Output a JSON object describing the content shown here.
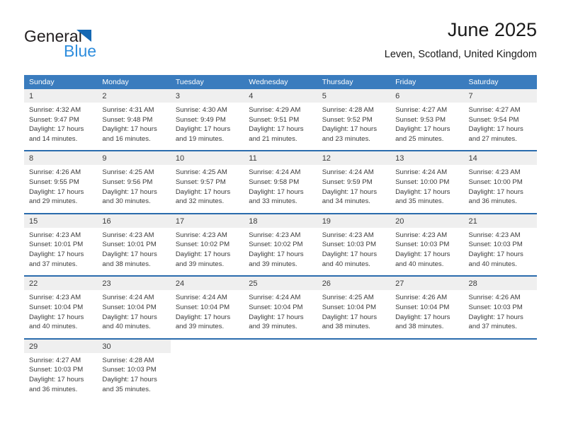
{
  "brand": {
    "name_top": "General",
    "name_bottom": "Blue",
    "triangle_color": "#1668b3",
    "blue_color": "#2e8ddd"
  },
  "header": {
    "title": "June 2025",
    "subtitle": "Leven, Scotland, United Kingdom"
  },
  "theme": {
    "header_bg": "#3a7cbe",
    "row_separator": "#2b6cad",
    "day_number_bg": "#efefef",
    "text": "#3b3b3b"
  },
  "weekdays": [
    "Sunday",
    "Monday",
    "Tuesday",
    "Wednesday",
    "Thursday",
    "Friday",
    "Saturday"
  ],
  "labels": {
    "sunrise_prefix": "Sunrise:",
    "sunset_prefix": "Sunset:",
    "daylight_prefix": "Daylight:"
  },
  "weeks": [
    {
      "days": [
        {
          "n": "1",
          "l1": "Sunrise: 4:32 AM",
          "l2": "Sunset: 9:47 PM",
          "l3": "Daylight: 17 hours",
          "l4": "and 14 minutes."
        },
        {
          "n": "2",
          "l1": "Sunrise: 4:31 AM",
          "l2": "Sunset: 9:48 PM",
          "l3": "Daylight: 17 hours",
          "l4": "and 16 minutes."
        },
        {
          "n": "3",
          "l1": "Sunrise: 4:30 AM",
          "l2": "Sunset: 9:49 PM",
          "l3": "Daylight: 17 hours",
          "l4": "and 19 minutes."
        },
        {
          "n": "4",
          "l1": "Sunrise: 4:29 AM",
          "l2": "Sunset: 9:51 PM",
          "l3": "Daylight: 17 hours",
          "l4": "and 21 minutes."
        },
        {
          "n": "5",
          "l1": "Sunrise: 4:28 AM",
          "l2": "Sunset: 9:52 PM",
          "l3": "Daylight: 17 hours",
          "l4": "and 23 minutes."
        },
        {
          "n": "6",
          "l1": "Sunrise: 4:27 AM",
          "l2": "Sunset: 9:53 PM",
          "l3": "Daylight: 17 hours",
          "l4": "and 25 minutes."
        },
        {
          "n": "7",
          "l1": "Sunrise: 4:27 AM",
          "l2": "Sunset: 9:54 PM",
          "l3": "Daylight: 17 hours",
          "l4": "and 27 minutes."
        }
      ]
    },
    {
      "days": [
        {
          "n": "8",
          "l1": "Sunrise: 4:26 AM",
          "l2": "Sunset: 9:55 PM",
          "l3": "Daylight: 17 hours",
          "l4": "and 29 minutes."
        },
        {
          "n": "9",
          "l1": "Sunrise: 4:25 AM",
          "l2": "Sunset: 9:56 PM",
          "l3": "Daylight: 17 hours",
          "l4": "and 30 minutes."
        },
        {
          "n": "10",
          "l1": "Sunrise: 4:25 AM",
          "l2": "Sunset: 9:57 PM",
          "l3": "Daylight: 17 hours",
          "l4": "and 32 minutes."
        },
        {
          "n": "11",
          "l1": "Sunrise: 4:24 AM",
          "l2": "Sunset: 9:58 PM",
          "l3": "Daylight: 17 hours",
          "l4": "and 33 minutes."
        },
        {
          "n": "12",
          "l1": "Sunrise: 4:24 AM",
          "l2": "Sunset: 9:59 PM",
          "l3": "Daylight: 17 hours",
          "l4": "and 34 minutes."
        },
        {
          "n": "13",
          "l1": "Sunrise: 4:24 AM",
          "l2": "Sunset: 10:00 PM",
          "l3": "Daylight: 17 hours",
          "l4": "and 35 minutes."
        },
        {
          "n": "14",
          "l1": "Sunrise: 4:23 AM",
          "l2": "Sunset: 10:00 PM",
          "l3": "Daylight: 17 hours",
          "l4": "and 36 minutes."
        }
      ]
    },
    {
      "days": [
        {
          "n": "15",
          "l1": "Sunrise: 4:23 AM",
          "l2": "Sunset: 10:01 PM",
          "l3": "Daylight: 17 hours",
          "l4": "and 37 minutes."
        },
        {
          "n": "16",
          "l1": "Sunrise: 4:23 AM",
          "l2": "Sunset: 10:01 PM",
          "l3": "Daylight: 17 hours",
          "l4": "and 38 minutes."
        },
        {
          "n": "17",
          "l1": "Sunrise: 4:23 AM",
          "l2": "Sunset: 10:02 PM",
          "l3": "Daylight: 17 hours",
          "l4": "and 39 minutes."
        },
        {
          "n": "18",
          "l1": "Sunrise: 4:23 AM",
          "l2": "Sunset: 10:02 PM",
          "l3": "Daylight: 17 hours",
          "l4": "and 39 minutes."
        },
        {
          "n": "19",
          "l1": "Sunrise: 4:23 AM",
          "l2": "Sunset: 10:03 PM",
          "l3": "Daylight: 17 hours",
          "l4": "and 40 minutes."
        },
        {
          "n": "20",
          "l1": "Sunrise: 4:23 AM",
          "l2": "Sunset: 10:03 PM",
          "l3": "Daylight: 17 hours",
          "l4": "and 40 minutes."
        },
        {
          "n": "21",
          "l1": "Sunrise: 4:23 AM",
          "l2": "Sunset: 10:03 PM",
          "l3": "Daylight: 17 hours",
          "l4": "and 40 minutes."
        }
      ]
    },
    {
      "days": [
        {
          "n": "22",
          "l1": "Sunrise: 4:23 AM",
          "l2": "Sunset: 10:04 PM",
          "l3": "Daylight: 17 hours",
          "l4": "and 40 minutes."
        },
        {
          "n": "23",
          "l1": "Sunrise: 4:24 AM",
          "l2": "Sunset: 10:04 PM",
          "l3": "Daylight: 17 hours",
          "l4": "and 40 minutes."
        },
        {
          "n": "24",
          "l1": "Sunrise: 4:24 AM",
          "l2": "Sunset: 10:04 PM",
          "l3": "Daylight: 17 hours",
          "l4": "and 39 minutes."
        },
        {
          "n": "25",
          "l1": "Sunrise: 4:24 AM",
          "l2": "Sunset: 10:04 PM",
          "l3": "Daylight: 17 hours",
          "l4": "and 39 minutes."
        },
        {
          "n": "26",
          "l1": "Sunrise: 4:25 AM",
          "l2": "Sunset: 10:04 PM",
          "l3": "Daylight: 17 hours",
          "l4": "and 38 minutes."
        },
        {
          "n": "27",
          "l1": "Sunrise: 4:26 AM",
          "l2": "Sunset: 10:04 PM",
          "l3": "Daylight: 17 hours",
          "l4": "and 38 minutes."
        },
        {
          "n": "28",
          "l1": "Sunrise: 4:26 AM",
          "l2": "Sunset: 10:03 PM",
          "l3": "Daylight: 17 hours",
          "l4": "and 37 minutes."
        }
      ]
    },
    {
      "days": [
        {
          "n": "29",
          "l1": "Sunrise: 4:27 AM",
          "l2": "Sunset: 10:03 PM",
          "l3": "Daylight: 17 hours",
          "l4": "and 36 minutes."
        },
        {
          "n": "30",
          "l1": "Sunrise: 4:28 AM",
          "l2": "Sunset: 10:03 PM",
          "l3": "Daylight: 17 hours",
          "l4": "and 35 minutes."
        },
        {
          "n": "",
          "l1": "",
          "l2": "",
          "l3": "",
          "l4": ""
        },
        {
          "n": "",
          "l1": "",
          "l2": "",
          "l3": "",
          "l4": ""
        },
        {
          "n": "",
          "l1": "",
          "l2": "",
          "l3": "",
          "l4": ""
        },
        {
          "n": "",
          "l1": "",
          "l2": "",
          "l3": "",
          "l4": ""
        },
        {
          "n": "",
          "l1": "",
          "l2": "",
          "l3": "",
          "l4": ""
        }
      ]
    }
  ]
}
